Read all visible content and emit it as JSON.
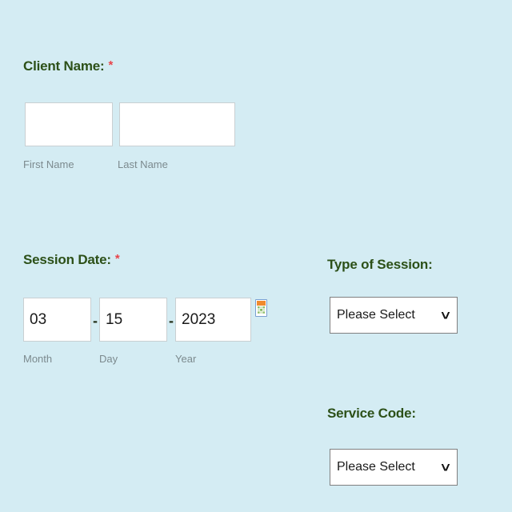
{
  "theme": {
    "page_background": "#d4ecf3",
    "label_color": "#2c5018",
    "required_marker_color": "#e8444a",
    "sub_label_color": "#7c8a8e",
    "input_background": "#ffffff",
    "input_border": "#c9cfd2",
    "select_border": "#808080"
  },
  "form": {
    "client_name": {
      "label": "Client Name:",
      "required_marker": "*",
      "first_name": {
        "value": "",
        "placeholder": "",
        "sub_label": "First Name"
      },
      "last_name": {
        "value": "",
        "placeholder": "",
        "sub_label": "Last Name"
      }
    },
    "session_date": {
      "label": "Session Date:",
      "required_marker": "*",
      "separator": "-",
      "month": {
        "value": "03",
        "placeholder": "",
        "sub_label": "Month"
      },
      "day": {
        "value": "15",
        "placeholder": "",
        "sub_label": "Day"
      },
      "year": {
        "value": "2023",
        "placeholder": "",
        "sub_label": "Year"
      },
      "picker_icon": "calendar-icon"
    },
    "type_of_session": {
      "label": "Type of Session:",
      "selected": "Please Select",
      "arrow_icon": "chevron-down-icon"
    },
    "service_code": {
      "label": "Service Code:",
      "selected": "Please Select",
      "arrow_icon": "chevron-down-icon"
    }
  }
}
